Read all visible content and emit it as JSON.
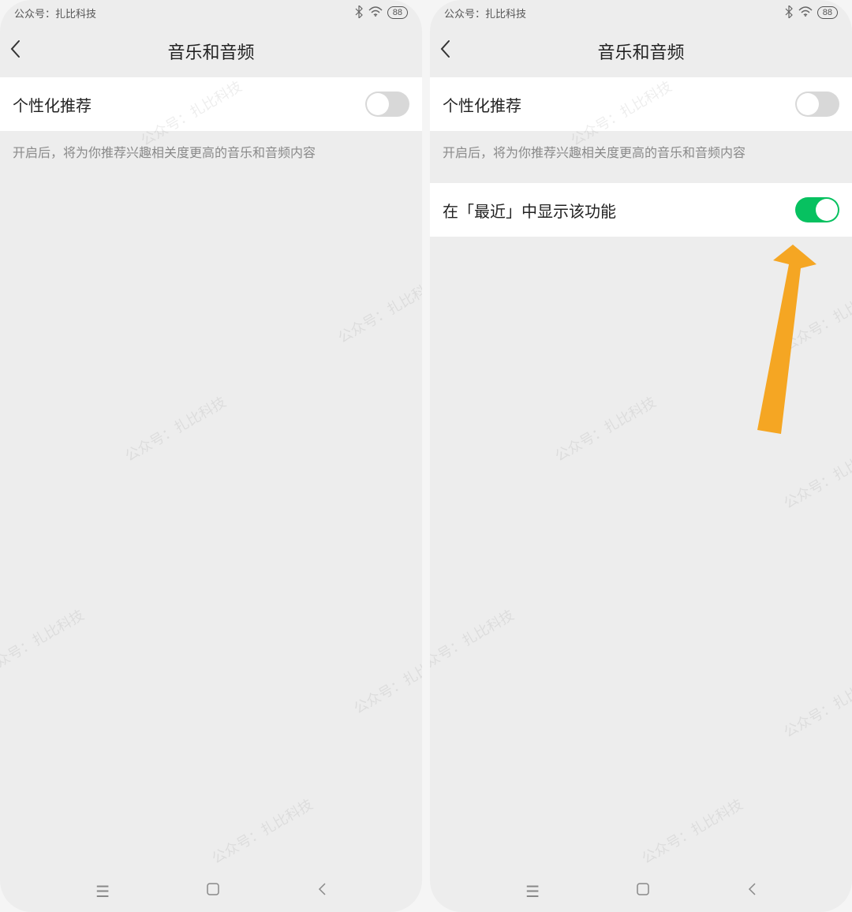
{
  "status_bar": {
    "left_text": "公众号：扎比科技",
    "battery": "88"
  },
  "header": {
    "title": "音乐和音频"
  },
  "settings": {
    "personalized": {
      "label": "个性化推荐",
      "description": "开启后，将为你推荐兴趣相关度更高的音乐和音频内容",
      "enabled_left": false,
      "enabled_right": false
    },
    "show_in_recent": {
      "label": "在「最近」中显示该功能",
      "enabled": true
    }
  },
  "watermark_text": "公众号：扎比科技",
  "colors": {
    "toggle_on": "#07c160",
    "toggle_off": "#d8d8d8",
    "arrow": "#f5a623"
  }
}
